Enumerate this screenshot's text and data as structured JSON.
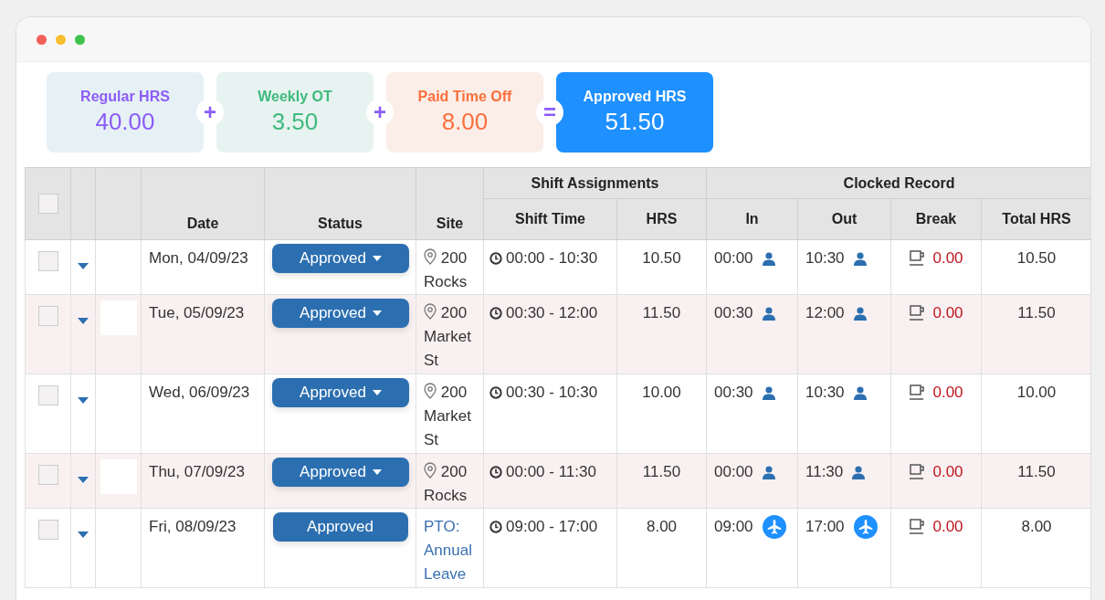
{
  "summary": [
    {
      "kind": "regular",
      "label": "Regular HRS",
      "value": "40.00",
      "operator": "+"
    },
    {
      "kind": "overtime",
      "label": "Weekly OT",
      "value": "3.50",
      "operator": "+"
    },
    {
      "kind": "pto",
      "label": "Paid Time Off",
      "value": "8.00",
      "operator": "="
    },
    {
      "kind": "total",
      "label": "Approved HRS",
      "value": "51.50"
    }
  ],
  "table": {
    "select_all": {
      "checked": false
    },
    "groups": [
      {
        "label": "Shift Assignments"
      },
      {
        "label": "Clocked Record"
      }
    ],
    "columns": [
      "Date",
      "Status",
      "Site",
      "Shift Time",
      "HRS",
      "In",
      "Out",
      "Break",
      "Total HRS"
    ],
    "rows": [
      {
        "kind": "shift",
        "highlighted": false,
        "checked": false,
        "date": "Mon, 04/09/23",
        "status": "Approved",
        "site": "200 Rocks",
        "shift_time": "00:00 - 10:30",
        "hrs": "10.50",
        "in": "00:00",
        "out": "10:30",
        "break": "0.00",
        "total": "10.50"
      },
      {
        "kind": "shift",
        "highlighted": true,
        "checked": false,
        "date": "Tue, 05/09/23",
        "status": "Approved",
        "site": "200 Market St",
        "shift_time": "00:30 - 12:00",
        "hrs": "11.50",
        "in": "00:30",
        "out": "12:00",
        "break": "0.00",
        "total": "11.50"
      },
      {
        "kind": "shift",
        "highlighted": false,
        "checked": false,
        "date": "Wed, 06/09/23",
        "status": "Approved",
        "site": "200 Market St",
        "shift_time": "00:30 - 10:30",
        "hrs": "10.00",
        "in": "00:30",
        "out": "10:30",
        "break": "0.00",
        "total": "10.00"
      },
      {
        "kind": "shift",
        "highlighted": true,
        "checked": false,
        "date": "Thu, 07/09/23",
        "status": "Approved",
        "site": "200 Rocks",
        "shift_time": "00:00 - 11:30",
        "hrs": "11.50",
        "in": "00:00",
        "out": "11:30",
        "break": "0.00",
        "total": "11.50"
      },
      {
        "kind": "pto",
        "highlighted": false,
        "checked": false,
        "date": "Fri, 08/09/23",
        "status": "Approved",
        "site": "PTO: Annual Leave",
        "shift_time": "09:00 - 17:00",
        "hrs": "8.00",
        "in": "09:00",
        "out": "17:00",
        "break": "0.00",
        "total": "8.00"
      }
    ]
  }
}
